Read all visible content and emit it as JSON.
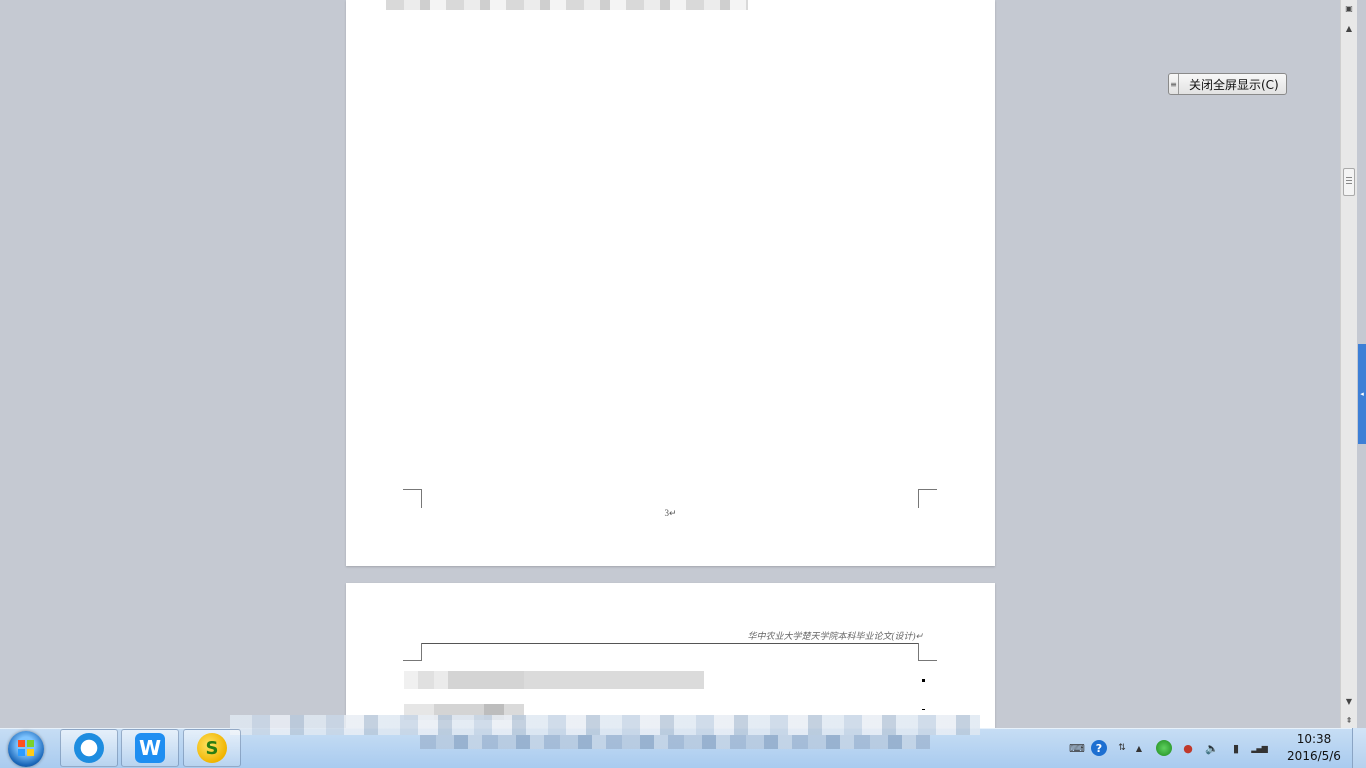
{
  "document": {
    "page_number": "3↵",
    "header_text": "华中农业大学楚天学院本科毕业论文(设计)↵"
  },
  "fullscreen": {
    "close_label": "关闭全屏显示(C)"
  },
  "icons": {
    "scroll_up": "▲",
    "scroll_down": "▼",
    "side_tab": "◂",
    "tray_keyboard": "⌨",
    "tray_help": "?",
    "tray_arrow": "▲",
    "tray_volume": "🔈",
    "tray_power": "▮",
    "tray_signal": "▂▄▆",
    "wps_letter": "W",
    "music_letter": "S"
  },
  "taskbar": {
    "time": "10:38",
    "date": "2016/5/6"
  }
}
